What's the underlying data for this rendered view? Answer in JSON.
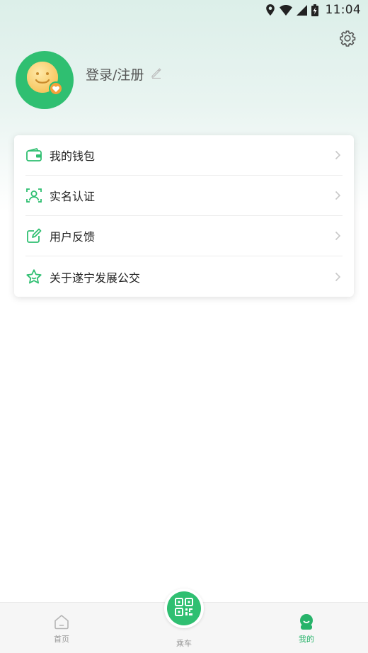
{
  "status_bar": {
    "time": "11:04",
    "icons": [
      "location-icon",
      "wifi-icon",
      "signal-icon",
      "battery-charging-icon"
    ]
  },
  "header": {
    "login_label": "登录/注册",
    "avatar_icon": "smiley-avatar-icon",
    "settings_icon": "gear-icon",
    "edit_icon": "pencil-icon"
  },
  "menu": {
    "items": [
      {
        "label": "我的钱包",
        "icon": "wallet-icon"
      },
      {
        "label": "实名认证",
        "icon": "id-verify-icon"
      },
      {
        "label": "用户反馈",
        "icon": "feedback-icon"
      },
      {
        "label": "关于遂宁发展公交",
        "icon": "star-icon"
      }
    ]
  },
  "bottom_nav": {
    "home_label": "首页",
    "ride_label": "乘车",
    "mine_label": "我的"
  },
  "colors": {
    "accent": "#2fbf71",
    "badge": "#f5a03a",
    "text_primary": "#222222",
    "text_muted": "#999999"
  }
}
